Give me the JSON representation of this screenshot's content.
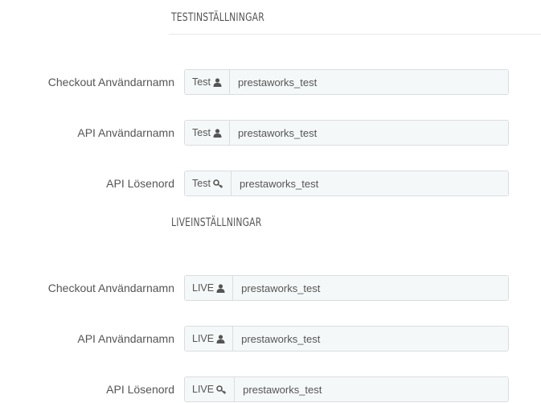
{
  "test_section": {
    "title": "TESTINSTÄLLNINGAR",
    "rows": [
      {
        "label": "Checkout Användarnamn",
        "addon": "Test",
        "icon": "user-icon",
        "value": "prestaworks_test"
      },
      {
        "label": "API Användarnamn",
        "addon": "Test",
        "icon": "user-icon",
        "value": "prestaworks_test"
      },
      {
        "label": "API Lösenord",
        "addon": "Test",
        "icon": "key-icon",
        "value": "prestaworks_test"
      }
    ]
  },
  "live_section": {
    "title": "LIVEINSTÄLLNINGAR",
    "rows": [
      {
        "label": "Checkout Användarnamn",
        "addon": "LIVE",
        "icon": "user-icon",
        "value": "prestaworks_test"
      },
      {
        "label": "API Användarnamn",
        "addon": "LIVE",
        "icon": "user-icon",
        "value": "prestaworks_test"
      },
      {
        "label": "API Lösenord",
        "addon": "LIVE",
        "icon": "key-icon",
        "value": "prestaworks_test"
      }
    ]
  },
  "colors": {
    "text": "#555555",
    "input_bg": "#f5f8f9",
    "input_border": "#d9dde0",
    "rule": "#e8e8e8"
  }
}
